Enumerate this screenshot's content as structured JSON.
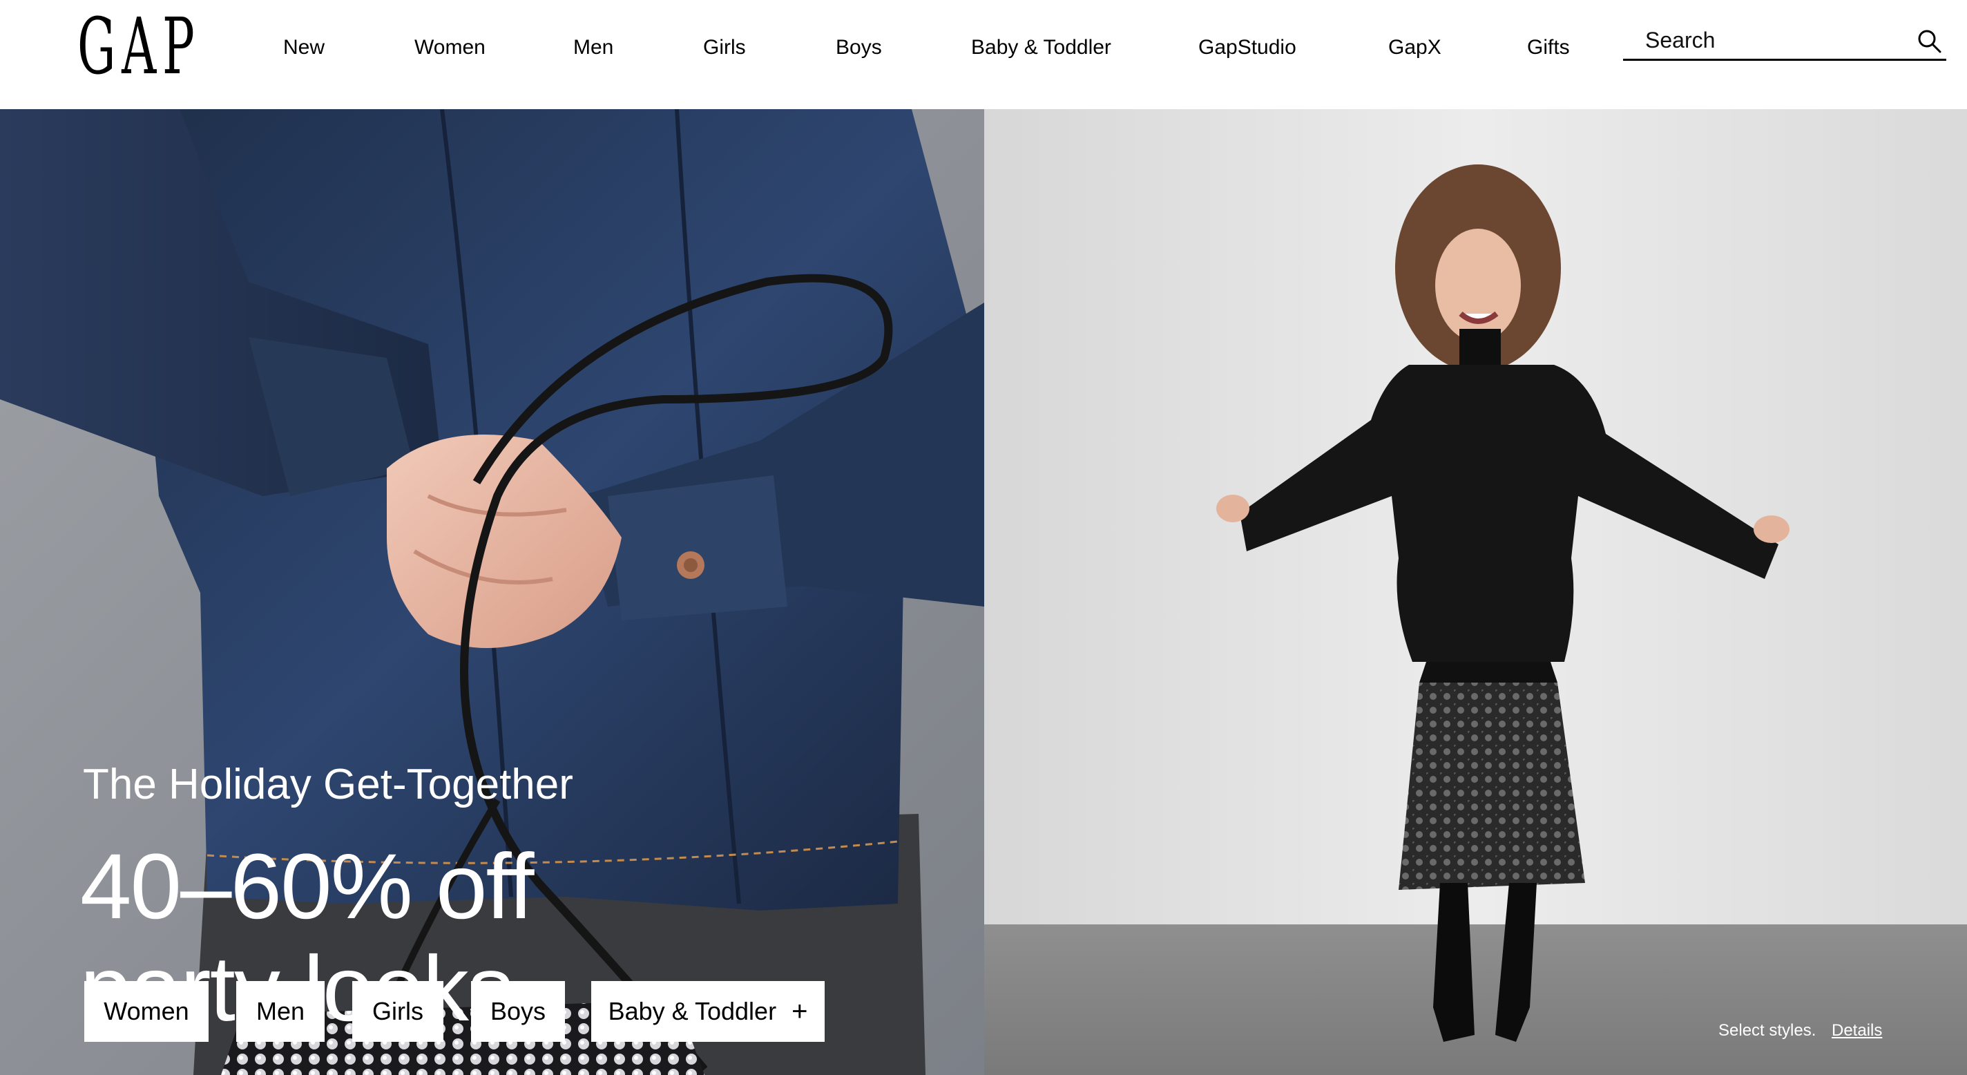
{
  "brand": {
    "logo_text": "GAP"
  },
  "nav": {
    "items": [
      {
        "label": "New"
      },
      {
        "label": "Women"
      },
      {
        "label": "Men"
      },
      {
        "label": "Girls"
      },
      {
        "label": "Boys"
      },
      {
        "label": "Baby & Toddler"
      },
      {
        "label": "GapStudio"
      },
      {
        "label": "GapX"
      },
      {
        "label": "Gifts"
      }
    ]
  },
  "search": {
    "placeholder": "Search",
    "value": "",
    "icon": "search-icon"
  },
  "promo": {
    "eyebrow": "The Holiday Get-Together",
    "headline_line1": "40–60% off",
    "headline_line2": "party looks",
    "ctas": [
      {
        "label": "Women"
      },
      {
        "label": "Men"
      },
      {
        "label": "Girls"
      },
      {
        "label": "Boys"
      },
      {
        "label": "Baby & Toddler",
        "icon": "plus-icon",
        "icon_glyph": "+"
      }
    ],
    "fineprint": "Select styles.",
    "details_link": "Details"
  },
  "colors": {
    "text": "#000000",
    "background": "#ffffff",
    "denim": "#22375a",
    "promo_text": "#ffffff"
  }
}
